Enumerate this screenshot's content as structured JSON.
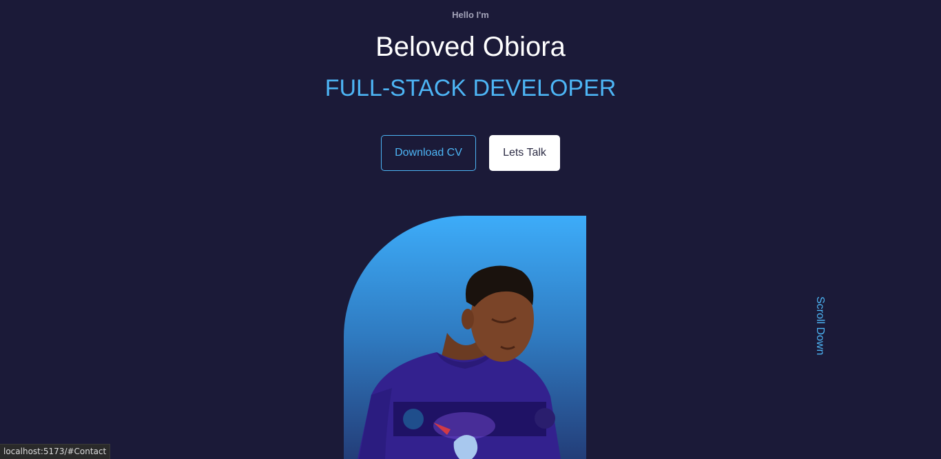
{
  "hero": {
    "greeting": "Hello I'm",
    "name": "Beloved Obiora",
    "role": "FULL-STACK DEVELOPER"
  },
  "buttons": {
    "download_cv": "Download CV",
    "lets_talk": "Lets Talk"
  },
  "scroll": {
    "label": "Scroll Down"
  },
  "status_bar": {
    "url": "localhost:5173/#Contact"
  },
  "colors": {
    "background": "#1b1a38",
    "accent": "#4db5f5",
    "text": "#ffffff",
    "muted": "#a3a3b8"
  }
}
